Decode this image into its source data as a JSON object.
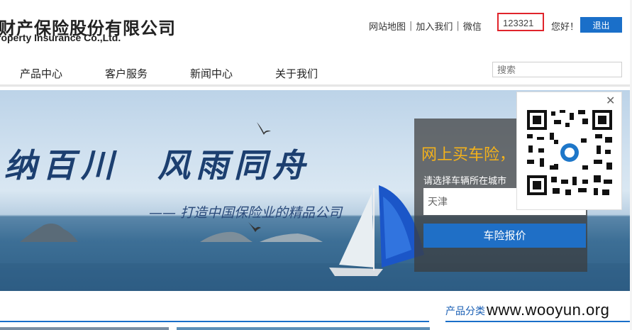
{
  "header": {
    "logo_cn": "财产保险股份有限公司",
    "logo_en": "roperty Insurance Co.,Ltd.",
    "links": [
      "网站地图",
      "加入我们",
      "微信"
    ],
    "username": "123321",
    "greeting": "您好！",
    "logout_label": "退出"
  },
  "nav": {
    "items": [
      "产品中心",
      "客户服务",
      "新闻中心",
      "关于我们"
    ],
    "search_placeholder": "搜索"
  },
  "banner": {
    "headline": "纳百川　风雨同舟",
    "tagline": "—— 打造中国保险业的精品公司"
  },
  "quote_panel": {
    "title": "网上买车险，",
    "city_label": "请选择车辆所在城市",
    "city_value": "天津",
    "button_label": "车险报价"
  },
  "qr_popup": {
    "close_icon": "close-icon",
    "qr_icon": "qr-code-icon"
  },
  "section": {
    "category_title": "产品分类"
  },
  "watermark": "www.wooyun.org",
  "colors": {
    "accent_blue": "#1a6fc9",
    "highlight_red": "#e0242b",
    "panel_title_gold": "#f4b21b"
  }
}
